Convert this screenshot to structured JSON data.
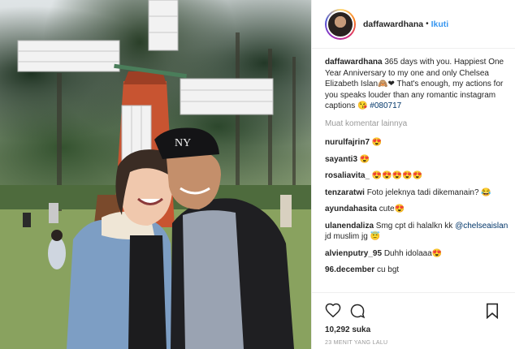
{
  "header": {
    "username": "daffawardhana",
    "separator": "•",
    "follow_label": "Ikuti"
  },
  "caption": {
    "username": "daffawardhana",
    "text": "365 days with you. Happiest One Year Anniversary to my one and only Chelsea Elizabeth Islan🙈❤ That's enough, my actions for you speaks louder than any romantic instagram captions 😘",
    "hashtag": "#080717"
  },
  "load_more_label": "Muat komentar lainnya",
  "comments": [
    {
      "username": "nurulfajrin7",
      "text": "😍"
    },
    {
      "username": "sayanti3",
      "text": "😍"
    },
    {
      "username": "rosaliavita_",
      "text": "😍😍😍😍😍"
    },
    {
      "username": "tenzaratwi",
      "text": "Foto jeleknya tadi dikemanain? 😂"
    },
    {
      "username": "ayundahasita",
      "text": "cute😍"
    },
    {
      "username": "ulanendaliza",
      "text": "Smg cpt di halalkn kk",
      "mention": "@chelseaislan",
      "after": "jd muslim jg 😇"
    },
    {
      "username": "alvienputry_95",
      "text": "Duhh idolaaa😍"
    },
    {
      "username": "96.december",
      "text": "cu bgt"
    }
  ],
  "icons": {
    "like": "heart-icon",
    "comment": "comment-icon",
    "save": "bookmark-icon"
  },
  "likes_label": "10,292 suka",
  "timestamp": "23 MENIT YANG LALU",
  "colors": {
    "link_blue": "#3897f0",
    "mention_blue": "#003569",
    "muted": "#999999",
    "windmill_red": "#d9532c"
  }
}
